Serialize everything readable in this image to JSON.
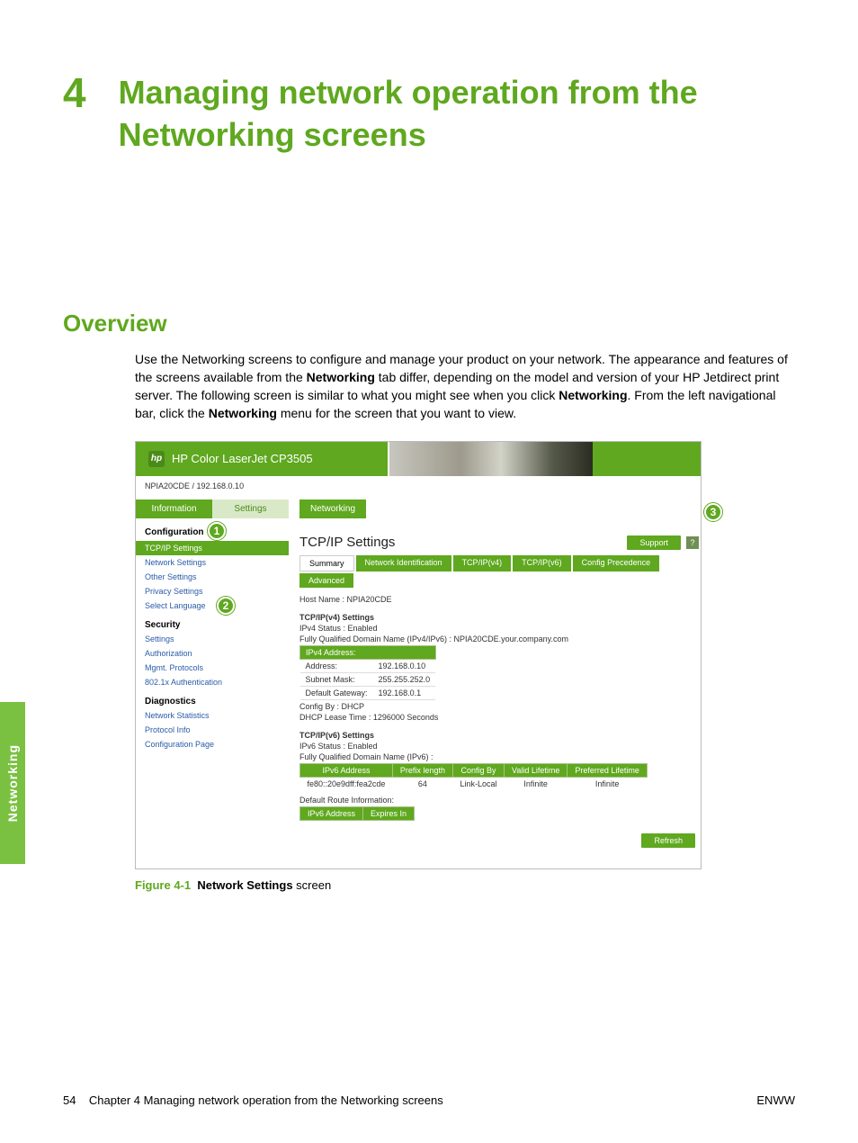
{
  "page": {
    "side_tab": "Networking",
    "chapter_num": "4",
    "chapter_title": "Managing network operation from the Networking screens",
    "section_title": "Overview",
    "body_html": "Use the Networking screens to configure and manage your product on your network. The appearance and features of the screens available from the <b>Networking</b> tab differ, depending on the model and version of your HP Jetdirect print server. The following screen is similar to what you might see when you click <b>Networking</b>. From the left navigational bar, click the <b>Networking</b> menu for the screen that you want to view.",
    "figure_label": "Figure 4-1",
    "figure_caption_bold": "Network Settings",
    "figure_caption_rest": " screen",
    "footer_left_page": "54",
    "footer_left_text": "Chapter 4   Managing network operation from the Networking screens",
    "footer_right": "ENWW"
  },
  "callouts": {
    "one": "1",
    "two": "2",
    "three": "3"
  },
  "shot": {
    "product": "HP Color LaserJet CP3505",
    "logo": "hp",
    "breadcrumb": "NPIA20CDE / 192.168.0.10",
    "toptabs": {
      "info": "Information",
      "settings": "Settings",
      "networking": "Networking"
    },
    "left": {
      "configuration": "Configuration",
      "items_a": [
        "TCP/IP Settings",
        "Network Settings",
        "Other Settings",
        "Privacy Settings",
        "Select Language"
      ],
      "security": "Security",
      "items_b": [
        "Settings",
        "Authorization",
        "Mgmt. Protocols",
        "802.1x Authentication"
      ],
      "diagnostics": "Diagnostics",
      "items_c": [
        "Network Statistics",
        "Protocol Info",
        "Configuration Page"
      ]
    },
    "right": {
      "pane_title": "TCP/IP Settings",
      "support": "Support",
      "help": "?",
      "tabs": [
        "Summary",
        "Network Identification",
        "TCP/IP(v4)",
        "TCP/IP(v6)",
        "Config Precedence",
        "Advanced"
      ],
      "hostname": "Host Name : NPIA20CDE",
      "v4_head": "TCP/IP(v4) Settings",
      "v4_status": "IPv4 Status : Enabled",
      "v4_fqdn": "Fully Qualified Domain Name (IPv4/IPv6) :  NPIA20CDE.your.company.com",
      "v4_addr_head": "IPv4 Address:",
      "v4_rows": [
        {
          "k": "Address:",
          "v": "192.168.0.10"
        },
        {
          "k": "Subnet Mask:",
          "v": "255.255.252.0"
        },
        {
          "k": "Default Gateway:",
          "v": "192.168.0.1"
        }
      ],
      "v4_cfg": "Config By          : DHCP",
      "v4_lease": "DHCP Lease Time : 1296000 Seconds",
      "v6_head": "TCP/IP(v6) Settings",
      "v6_status": "IPv6 Status :  Enabled",
      "v6_fqdn": "Fully Qualified Domain Name (IPv6) :",
      "v6_cols": [
        "IPv6 Address",
        "Prefix length",
        "Config By",
        "Valid Lifetime",
        "Preferred Lifetime"
      ],
      "v6_row": [
        "fe80::20e9dff:fea2cde",
        "64",
        "Link-Local",
        "Infinite",
        "Infinite"
      ],
      "v6_route": "Default Route Information:",
      "v6_route_cols": [
        "IPv6 Address",
        "Expires In"
      ],
      "refresh": "Refresh"
    }
  }
}
